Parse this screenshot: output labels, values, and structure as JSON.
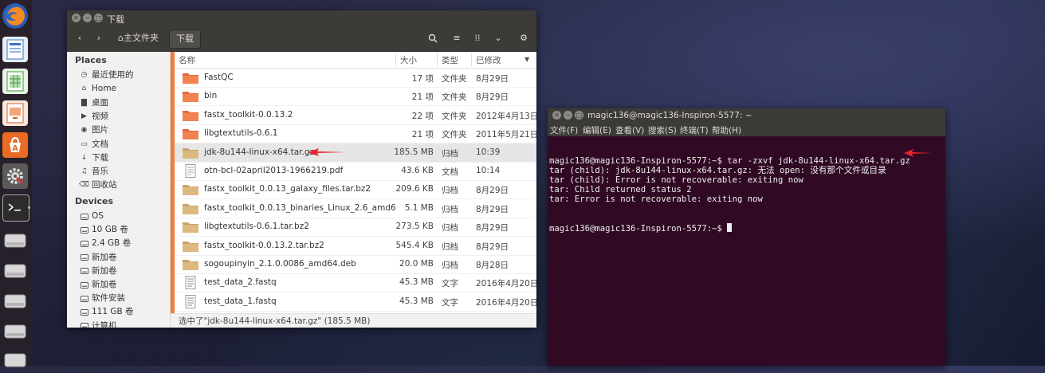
{
  "launcher": {
    "items": [
      {
        "icon": "firefox-icon"
      },
      {
        "icon": "writer-icon"
      },
      {
        "icon": "calc-icon"
      },
      {
        "icon": "impress-icon"
      },
      {
        "icon": "software-center-icon"
      },
      {
        "icon": "settings-icon"
      },
      {
        "icon": "terminal-icon"
      },
      {
        "icon": "drive-icon"
      },
      {
        "icon": "drive-icon"
      },
      {
        "icon": "drive-icon"
      },
      {
        "icon": "drive-icon"
      },
      {
        "icon": "drive-icon"
      }
    ]
  },
  "file_manager": {
    "title": "下载",
    "breadcrumb": {
      "home": "主文件夹",
      "current": "下载"
    },
    "sidebar": {
      "places_label": "Places",
      "places": [
        {
          "label": "最近使用的",
          "icon": "clock-icon"
        },
        {
          "label": "Home",
          "icon": "home-icon"
        },
        {
          "label": "桌面",
          "icon": "desktop-icon"
        },
        {
          "label": "视频",
          "icon": "video-icon"
        },
        {
          "label": "图片",
          "icon": "camera-icon"
        },
        {
          "label": "文档",
          "icon": "document-icon"
        },
        {
          "label": "下载",
          "icon": "download-icon"
        },
        {
          "label": "音乐",
          "icon": "music-icon"
        },
        {
          "label": "回收站",
          "icon": "trash-icon"
        }
      ],
      "devices_label": "Devices",
      "devices": [
        {
          "label": "OS"
        },
        {
          "label": "10 GB 卷"
        },
        {
          "label": "2.4 GB 卷"
        },
        {
          "label": "新加卷"
        },
        {
          "label": "新加卷"
        },
        {
          "label": "新加卷"
        },
        {
          "label": "软件安装"
        },
        {
          "label": "111 GB 卷"
        },
        {
          "label": "计算机"
        }
      ]
    },
    "columns": {
      "name": "名称",
      "size": "大小",
      "type": "类型",
      "modified": "已修改"
    },
    "files": [
      {
        "name": "FastQC",
        "size": "17 项",
        "type": "文件夹",
        "date": "8月29日",
        "kind": "folder"
      },
      {
        "name": "bin",
        "size": "21 项",
        "type": "文件夹",
        "date": "8月29日",
        "kind": "folder"
      },
      {
        "name": "fastx_toolkit-0.0.13.2",
        "size": "22 项",
        "type": "文件夹",
        "date": "2012年4月13日",
        "kind": "folder"
      },
      {
        "name": "libgtextutils-0.6.1",
        "size": "21 项",
        "type": "文件夹",
        "date": "2011年5月21日",
        "kind": "folder"
      },
      {
        "name": "jdk-8u144-linux-x64.tar.gz",
        "size": "185.5 MB",
        "type": "归档",
        "date": "10:39",
        "kind": "archive",
        "selected": true
      },
      {
        "name": "otn-bcl-02april2013-1966219.pdf",
        "size": "43.6 KB",
        "type": "文档",
        "date": "10:14",
        "kind": "pdf"
      },
      {
        "name": "fastx_toolkit_0.0.13_galaxy_files.tar.bz2",
        "size": "209.6 KB",
        "type": "归档",
        "date": "8月29日",
        "kind": "archive"
      },
      {
        "name": "fastx_toolkit_0.0.13_binaries_Linux_2.6_amd64....",
        "size": "5.1 MB",
        "type": "归档",
        "date": "8月29日",
        "kind": "archive"
      },
      {
        "name": "libgtextutils-0.6.1.tar.bz2",
        "size": "273.5 KB",
        "type": "归档",
        "date": "8月29日",
        "kind": "archive"
      },
      {
        "name": "fastx_toolkit-0.0.13.2.tar.bz2",
        "size": "545.4 KB",
        "type": "归档",
        "date": "8月29日",
        "kind": "archive"
      },
      {
        "name": "sogoupinyin_2.1.0.0086_amd64.deb",
        "size": "20.0 MB",
        "type": "归档",
        "date": "8月28日",
        "kind": "archive"
      },
      {
        "name": "test_data_2.fastq",
        "size": "45.3 MB",
        "type": "文字",
        "date": "2016年4月20日",
        "kind": "text"
      },
      {
        "name": "test_data_1.fastq",
        "size": "45.3 MB",
        "type": "文字",
        "date": "2016年4月20日",
        "kind": "text"
      }
    ],
    "status": "选中了\"jdk-8u144-linux-x64.tar.gz\" (185.5 MB)"
  },
  "terminal": {
    "title": "magic136@magic136-Inspiron-5577: ~",
    "menu": [
      "文件(F)",
      "编辑(E)",
      "查看(V)",
      "搜索(S)",
      "终端(T)",
      "帮助(H)"
    ],
    "lines": [
      "magic136@magic136-Inspiron-5577:~$ tar -zxvf jdk-8u144-linux-x64.tar.gz",
      "tar (child): jdk-8u144-linux-x64.tar.gz: 无法 open: 没有那个文件或目录",
      "tar (child): Error is not recoverable: exiting now",
      "tar: Child returned status 2",
      "tar: Error is not recoverable: exiting now"
    ],
    "prompt": "magic136@magic136-Inspiron-5577:~$ "
  },
  "colors": {
    "accent": "#ef7d3c",
    "terminal_bg": "#300a24",
    "titlebar": "#3c3b37",
    "arrow": "#e8262c"
  }
}
